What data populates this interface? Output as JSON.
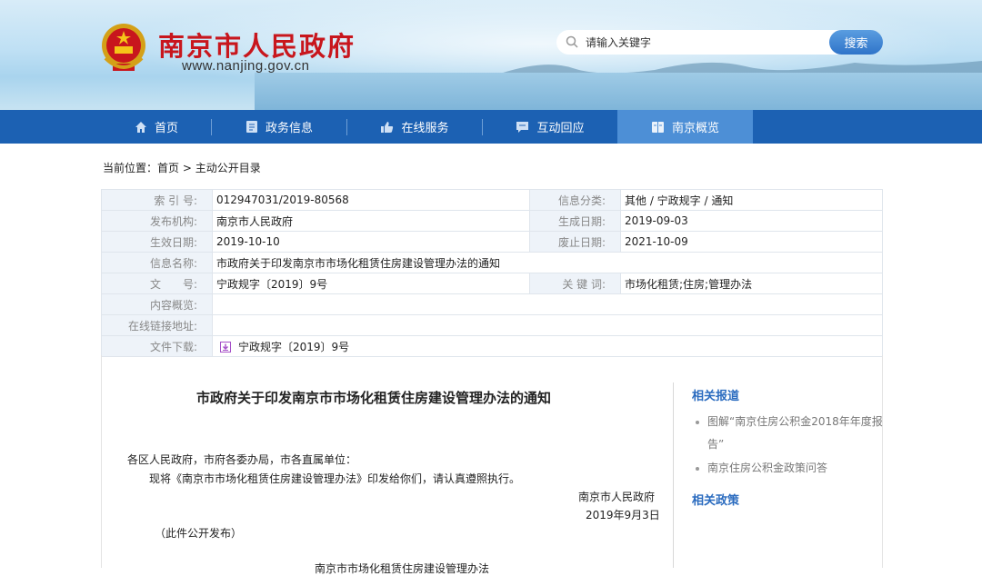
{
  "header": {
    "site_title": "南京市人民政府",
    "site_url": "www.nanjing.gov.cn",
    "search_placeholder": "请输入关键字",
    "search_button": "搜索"
  },
  "nav": {
    "items": [
      {
        "label": "首页",
        "icon": "home-icon"
      },
      {
        "label": "政务信息",
        "icon": "document-icon"
      },
      {
        "label": "在线服务",
        "icon": "thumb-icon"
      },
      {
        "label": "互动回应",
        "icon": "chat-icon"
      },
      {
        "label": "南京概览",
        "icon": "book-icon",
        "active": true
      }
    ]
  },
  "breadcrumb": {
    "prefix": "当前位置：",
    "home": "首页",
    "sep": " > ",
    "current": "主动公开目录"
  },
  "info": {
    "index_no_label": "索 引 号:",
    "index_no": "012947031/2019-80568",
    "category_label": "信息分类:",
    "category": "其他 / 宁政规字 / 通知",
    "publisher_label": "发布机构:",
    "publisher": "南京市人民政府",
    "created_label": "生成日期:",
    "created": "2019-09-03",
    "effective_label": "生效日期:",
    "effective": "2019-10-10",
    "expire_label": "废止日期:",
    "expire": "2021-10-09",
    "name_label": "信息名称:",
    "name": "市政府关于印发南京市市场化租赁住房建设管理办法的通知",
    "docno_label": "文　　号:",
    "docno": "宁政规字〔2019〕9号",
    "keywords_label": "关 键 词:",
    "keywords": "市场化租赁;住房;管理办法",
    "summary_label": "内容概览:",
    "summary": "",
    "link_label": "在线链接地址:",
    "link": "",
    "download_label": "文件下载:",
    "download": "宁政规字〔2019〕9号"
  },
  "article": {
    "title": "市政府关于印发南京市市场化租赁住房建设管理办法的通知",
    "salutation": "各区人民政府，市府各委办局，市各直属单位：",
    "body": "现将《南京市市场化租赁住房建设管理办法》印发给你们，请认真遵照执行。",
    "signer": "南京市人民政府",
    "date": "2019年9月3日",
    "note": "（此件公开发布）",
    "next_title_partial": "南京市市场化租赁住房建设管理办法"
  },
  "sidebar": {
    "reports_heading": "相关报道",
    "reports": [
      "图解“南京住房公积金2018年年度报告”",
      "南京住房公积金政策问答"
    ],
    "policies_heading": "相关政策"
  },
  "colors": {
    "brand_red": "#c8161d",
    "nav_blue": "#1c61b3",
    "nav_active": "#4d8fd6",
    "link_blue": "#2a6bbf"
  }
}
